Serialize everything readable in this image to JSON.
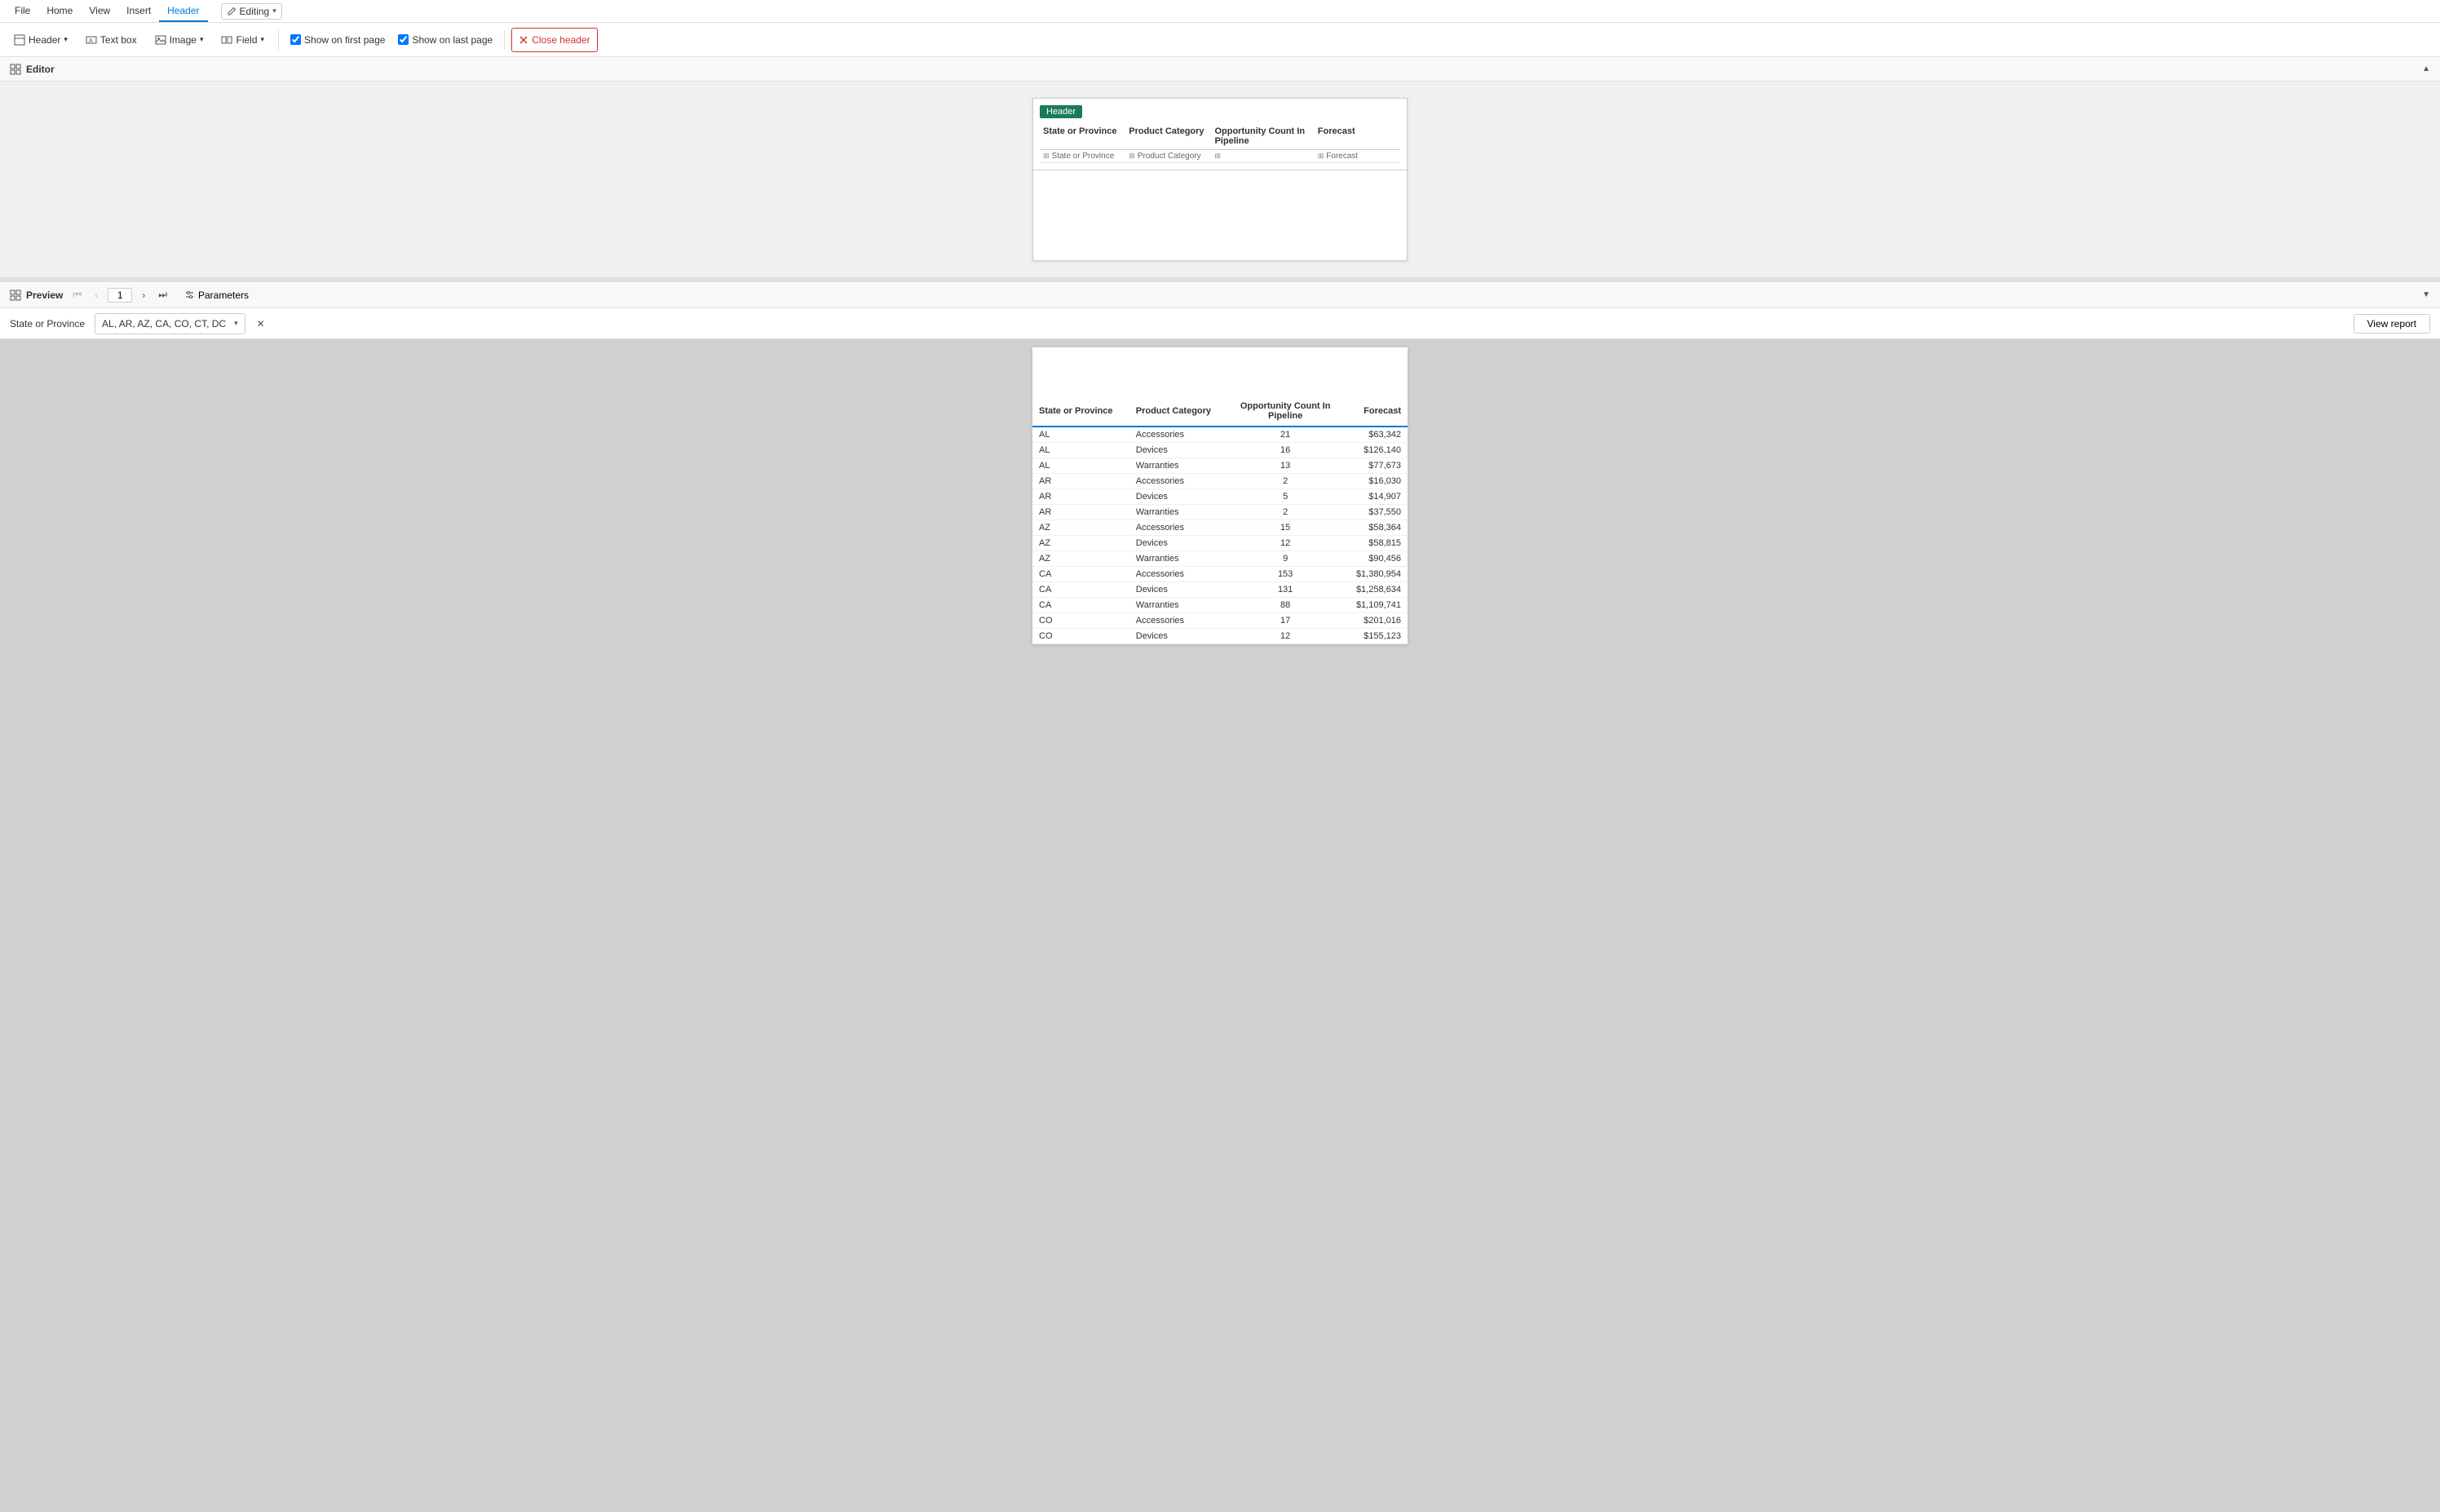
{
  "menu": {
    "items": [
      "File",
      "Home",
      "View",
      "Insert"
    ],
    "active_tab": "Header",
    "tabs": [
      "Header"
    ],
    "editing_label": "Editing"
  },
  "toolbar": {
    "header_btn": "Header",
    "textbox_btn": "Text box",
    "image_btn": "Image",
    "field_btn": "Field",
    "show_first_page": "Show on first page",
    "show_last_page": "Show on last page",
    "close_header_btn": "Close header",
    "show_first_checked": true,
    "show_last_checked": true
  },
  "editor": {
    "title": "Editor",
    "header_tag": "Header",
    "columns": [
      {
        "label": "State or Province",
        "icon": "🗂"
      },
      {
        "label": "Product Category",
        "icon": "🗂"
      },
      {
        "label": "Opportunity Count In Pipeline",
        "icon": "🔢"
      },
      {
        "label": "Forecast",
        "icon": "🗂"
      }
    ],
    "data_rows": [
      [
        "State or Province",
        "Product Category",
        "",
        "Forecast"
      ]
    ]
  },
  "preview": {
    "title": "Preview",
    "page_number": "1",
    "parameters_btn": "Parameters"
  },
  "parameters": {
    "label": "State or Province",
    "value": "AL, AR, AZ, CA, CO, CT, DC",
    "view_report_btn": "View report"
  },
  "table": {
    "headers": [
      {
        "label": "State or Province",
        "align": "left"
      },
      {
        "label": "Product Category",
        "align": "left"
      },
      {
        "label": "Opportunity Count In Pipeline",
        "align": "center"
      },
      {
        "label": "Forecast",
        "align": "right"
      }
    ],
    "rows": [
      {
        "state": "AL",
        "product": "Accessories",
        "count": "21",
        "forecast": "$63,342"
      },
      {
        "state": "AL",
        "product": "Devices",
        "count": "16",
        "forecast": "$126,140"
      },
      {
        "state": "AL",
        "product": "Warranties",
        "count": "13",
        "forecast": "$77,673"
      },
      {
        "state": "AR",
        "product": "Accessories",
        "count": "2",
        "forecast": "$16,030"
      },
      {
        "state": "AR",
        "product": "Devices",
        "count": "5",
        "forecast": "$14,907"
      },
      {
        "state": "AR",
        "product": "Warranties",
        "count": "2",
        "forecast": "$37,550"
      },
      {
        "state": "AZ",
        "product": "Accessories",
        "count": "15",
        "forecast": "$58,364"
      },
      {
        "state": "AZ",
        "product": "Devices",
        "count": "12",
        "forecast": "$58,815"
      },
      {
        "state": "AZ",
        "product": "Warranties",
        "count": "9",
        "forecast": "$90,456"
      },
      {
        "state": "CA",
        "product": "Accessories",
        "count": "153",
        "forecast": "$1,380,954"
      },
      {
        "state": "CA",
        "product": "Devices",
        "count": "131",
        "forecast": "$1,258,634"
      },
      {
        "state": "CA",
        "product": "Warranties",
        "count": "88",
        "forecast": "$1,109,741"
      },
      {
        "state": "CO",
        "product": "Accessories",
        "count": "17",
        "forecast": "$201,016"
      },
      {
        "state": "CO",
        "product": "Devices",
        "count": "12",
        "forecast": "$155,123"
      }
    ]
  }
}
